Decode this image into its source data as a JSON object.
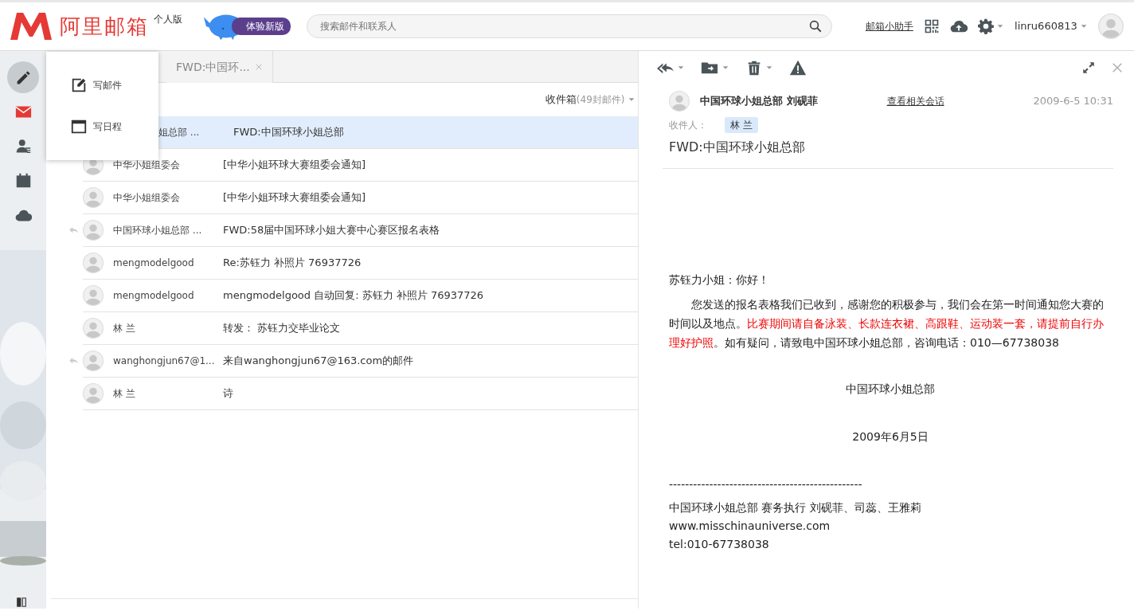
{
  "header": {
    "brand": "阿里邮箱",
    "edition": "个人版",
    "new_version": "体验新版",
    "search": {
      "placeholder": "搜索邮件和联系人"
    },
    "helper_link": "邮箱小助手",
    "user": "linru660813"
  },
  "rail": [
    {
      "kind": "compose",
      "selected": true
    },
    {
      "kind": "mail",
      "selected": false
    },
    {
      "kind": "contacts",
      "selected": false
    },
    {
      "kind": "calendar",
      "selected": false
    },
    {
      "kind": "cloud",
      "selected": false
    }
  ],
  "compose_menu": [
    {
      "kind": "mail",
      "label": "写邮件"
    },
    {
      "kind": "schedule",
      "label": "写日程"
    }
  ],
  "tabs": [
    {
      "label": "FWD:中国环...",
      "selected": false
    }
  ],
  "list": {
    "folder": "收件箱",
    "count": "(49封邮件)",
    "rows": [
      {
        "sender": "姐总部 ...",
        "subject": "FWD:中国环球小姐总部",
        "selected": true,
        "replied": false,
        "covered": true
      },
      {
        "sender": "中华小姐组委会",
        "subject": "[中华小姐环球大赛组委会通知]",
        "selected": false,
        "replied": false
      },
      {
        "sender": "中华小姐组委会",
        "subject": "[中华小姐环球大赛组委会通知]",
        "selected": false,
        "replied": false
      },
      {
        "sender": "中国环球小姐总部 ...",
        "subject": "FWD:58届中国环球小姐大赛中心赛区报名表格",
        "selected": false,
        "replied": true
      },
      {
        "sender": "mengmodelgood",
        "subject": "Re:苏钰力 补照片 76937726",
        "selected": false,
        "replied": false
      },
      {
        "sender": "mengmodelgood",
        "subject": "mengmodelgood 自动回复: 苏钰力 补照片 76937726",
        "selected": false,
        "replied": false
      },
      {
        "sender": "林 兰",
        "subject": "转发： 苏钰力交毕业论文",
        "selected": false,
        "replied": false
      },
      {
        "sender": "wanghongjun67@1...",
        "subject": "来自wanghongjun67@163.com的邮件",
        "selected": false,
        "replied": true
      },
      {
        "sender": "林 兰",
        "subject": "诗",
        "selected": false,
        "replied": false
      }
    ]
  },
  "reader": {
    "sender": "中国环球小姐总部 刘砚菲",
    "related_link": "查看相关会话",
    "date": "2009-6-5 10:31",
    "to_label": "收件人：",
    "to": [
      "林 兰"
    ],
    "subject": "FWD:中国环球小姐总部",
    "body": [
      {
        "kind": "line",
        "text": "苏钰力小姐：你好！"
      },
      {
        "kind": "indent",
        "segments": [
          {
            "text": "您发送的报名表格我们已收到，感谢您的积极参与，我们会在第一时间通知您大赛的时间以及地点。",
            "emphasis": false
          },
          {
            "text": "比赛期间请自备泳装、长款连衣裙、高跟鞋、运动装一套，请提前自行办理好护照",
            "emphasis": true
          },
          {
            "text": "。如有疑问，请致电中国环球小姐总部，咨询电话：010—67738038",
            "emphasis": false
          }
        ]
      },
      {
        "kind": "center",
        "text": "中国环球小姐总部"
      },
      {
        "kind": "center",
        "text": "2009年6月5日"
      },
      {
        "kind": "line",
        "text": "------------------------------------------------"
      },
      {
        "kind": "tight",
        "text": "中国环球小姐总部 赛务执行 刘砚菲、司蕊、王雅莉"
      },
      {
        "kind": "tight",
        "text": "www.misschinauniverse.com"
      },
      {
        "kind": "tight",
        "text": "tel:010-67738038"
      }
    ]
  }
}
